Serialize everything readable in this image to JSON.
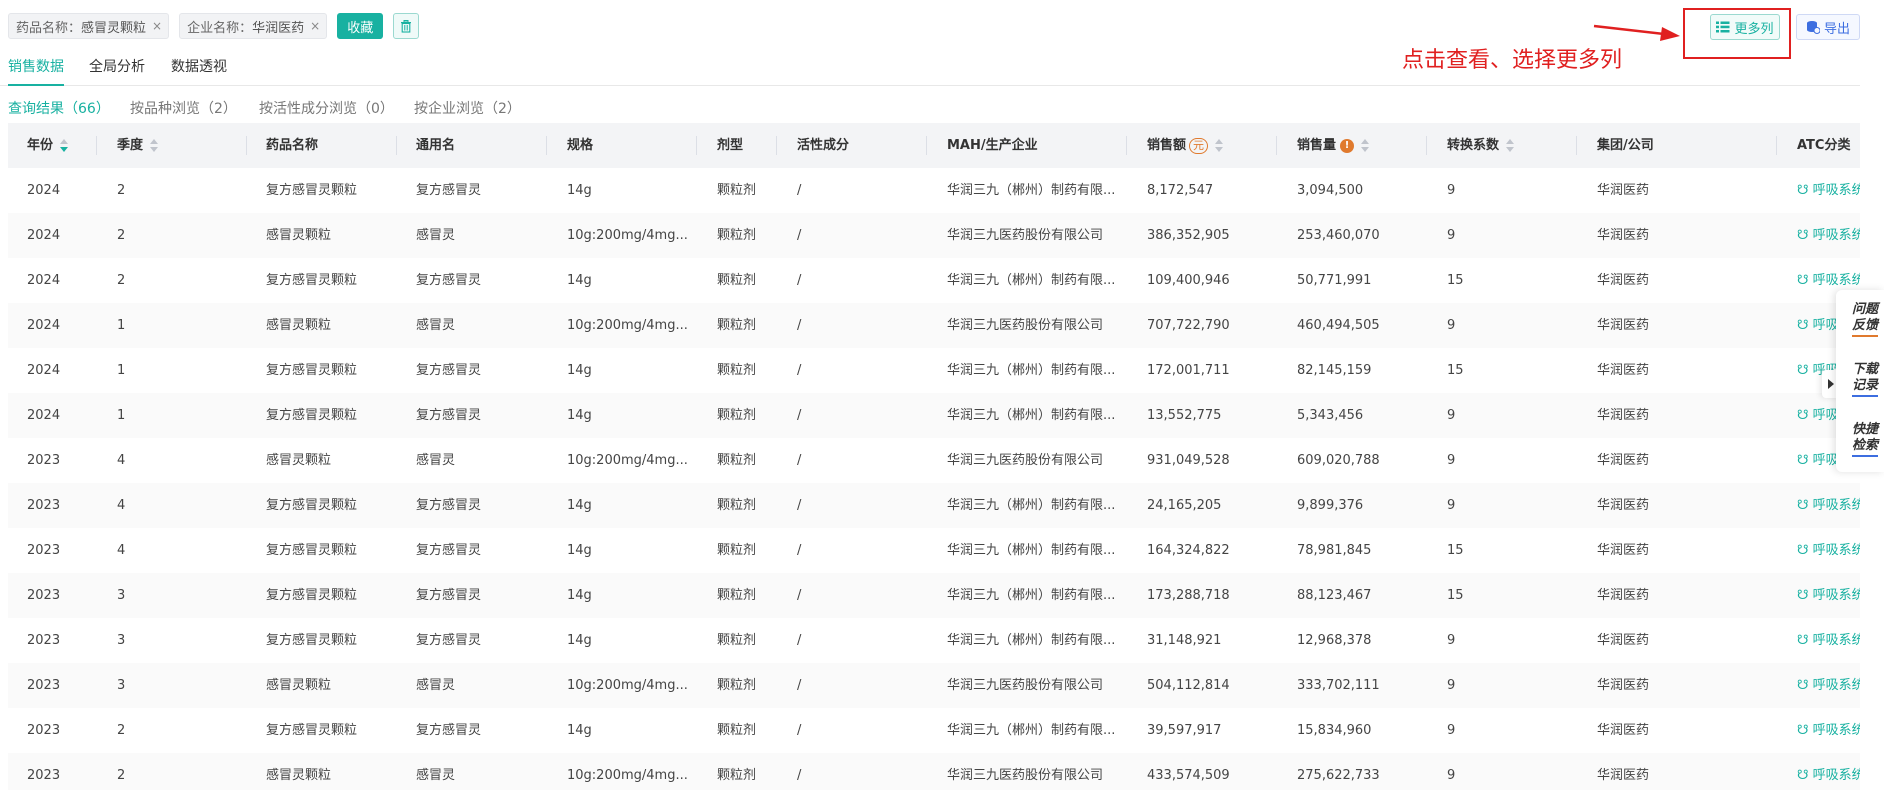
{
  "filters": {
    "tags": [
      {
        "label": "药品名称：",
        "value": "感冒灵颗粒",
        "close": "×"
      },
      {
        "label": "企业名称：",
        "value": "华润医药",
        "close": "×"
      }
    ],
    "favorite_label": "收藏"
  },
  "toolbar": {
    "more_columns_label": "更多列",
    "export_label": "导出"
  },
  "annotation": {
    "text": "点击查看、选择更多列",
    "color": "#e02020"
  },
  "main_tabs": [
    {
      "label": "销售数据",
      "active": true
    },
    {
      "label": "全局分析",
      "active": false
    },
    {
      "label": "数据透视",
      "active": false
    }
  ],
  "sub_tabs": [
    {
      "label": "查询结果（66）",
      "active": true
    },
    {
      "label": "按品种浏览（2）",
      "active": false
    },
    {
      "label": "按活性成分浏览（0）",
      "active": false
    },
    {
      "label": "按企业浏览（2）",
      "active": false
    }
  ],
  "table": {
    "columns": [
      {
        "key": "year",
        "label": "年份"
      },
      {
        "key": "quarter",
        "label": "季度"
      },
      {
        "key": "drug",
        "label": "药品名称"
      },
      {
        "key": "generic",
        "label": "通用名"
      },
      {
        "key": "spec",
        "label": "规格"
      },
      {
        "key": "form",
        "label": "剂型"
      },
      {
        "key": "active",
        "label": "活性成分"
      },
      {
        "key": "mah",
        "label": "MAH/生产企业"
      },
      {
        "key": "sales",
        "label": "销售额",
        "unit": "元"
      },
      {
        "key": "volume",
        "label": "销售量",
        "info": "!"
      },
      {
        "key": "factor",
        "label": "转换系数"
      },
      {
        "key": "group",
        "label": "集团/公司"
      },
      {
        "key": "atc",
        "label": "ATC分类"
      }
    ],
    "rows": [
      [
        "2024",
        "2",
        "复方感冒灵颗粒",
        "复方感冒灵",
        "14g",
        "颗粒剂",
        "/",
        "华润三九（郴州）制药有限...",
        "8,172,547",
        "3,094,500",
        "9",
        "华润医药",
        "☋ 呼吸系统"
      ],
      [
        "2024",
        "2",
        "感冒灵颗粒",
        "感冒灵",
        "10g:200mg/4mg...",
        "颗粒剂",
        "/",
        "华润三九医药股份有限公司",
        "386,352,905",
        "253,460,070",
        "9",
        "华润医药",
        "☋ 呼吸系统"
      ],
      [
        "2024",
        "2",
        "复方感冒灵颗粒",
        "复方感冒灵",
        "14g",
        "颗粒剂",
        "/",
        "华润三九（郴州）制药有限...",
        "109,400,946",
        "50,771,991",
        "15",
        "华润医药",
        "☋ 呼吸系统"
      ],
      [
        "2024",
        "1",
        "感冒灵颗粒",
        "感冒灵",
        "10g:200mg/4mg...",
        "颗粒剂",
        "/",
        "华润三九医药股份有限公司",
        "707,722,790",
        "460,494,505",
        "9",
        "华润医药",
        "☋ 呼吸系统"
      ],
      [
        "2024",
        "1",
        "复方感冒灵颗粒",
        "复方感冒灵",
        "14g",
        "颗粒剂",
        "/",
        "华润三九（郴州）制药有限...",
        "172,001,711",
        "82,145,159",
        "15",
        "华润医药",
        "☋ 呼吸系统"
      ],
      [
        "2024",
        "1",
        "复方感冒灵颗粒",
        "复方感冒灵",
        "14g",
        "颗粒剂",
        "/",
        "华润三九（郴州）制药有限...",
        "13,552,775",
        "5,343,456",
        "9",
        "华润医药",
        "☋ 呼吸系统"
      ],
      [
        "2023",
        "4",
        "感冒灵颗粒",
        "感冒灵",
        "10g:200mg/4mg...",
        "颗粒剂",
        "/",
        "华润三九医药股份有限公司",
        "931,049,528",
        "609,020,788",
        "9",
        "华润医药",
        "☋ 呼吸系统"
      ],
      [
        "2023",
        "4",
        "复方感冒灵颗粒",
        "复方感冒灵",
        "14g",
        "颗粒剂",
        "/",
        "华润三九（郴州）制药有限...",
        "24,165,205",
        "9,899,376",
        "9",
        "华润医药",
        "☋ 呼吸系统"
      ],
      [
        "2023",
        "4",
        "复方感冒灵颗粒",
        "复方感冒灵",
        "14g",
        "颗粒剂",
        "/",
        "华润三九（郴州）制药有限...",
        "164,324,822",
        "78,981,845",
        "15",
        "华润医药",
        "☋ 呼吸系统"
      ],
      [
        "2023",
        "3",
        "复方感冒灵颗粒",
        "复方感冒灵",
        "14g",
        "颗粒剂",
        "/",
        "华润三九（郴州）制药有限...",
        "173,288,718",
        "88,123,467",
        "15",
        "华润医药",
        "☋ 呼吸系统"
      ],
      [
        "2023",
        "3",
        "复方感冒灵颗粒",
        "复方感冒灵",
        "14g",
        "颗粒剂",
        "/",
        "华润三九（郴州）制药有限...",
        "31,148,921",
        "12,968,378",
        "9",
        "华润医药",
        "☋ 呼吸系统"
      ],
      [
        "2023",
        "3",
        "感冒灵颗粒",
        "感冒灵",
        "10g:200mg/4mg...",
        "颗粒剂",
        "/",
        "华润三九医药股份有限公司",
        "504,112,814",
        "333,702,111",
        "9",
        "华润医药",
        "☋ 呼吸系统"
      ],
      [
        "2023",
        "2",
        "复方感冒灵颗粒",
        "复方感冒灵",
        "14g",
        "颗粒剂",
        "/",
        "华润三九（郴州）制药有限...",
        "39,597,917",
        "15,834,960",
        "9",
        "华润医药",
        "☋ 呼吸系统"
      ],
      [
        "2023",
        "2",
        "感冒灵颗粒",
        "感冒灵",
        "10g:200mg/4mg...",
        "颗粒剂",
        "/",
        "华润三九医药股份有限公司",
        "433,574,509",
        "275,622,733",
        "9",
        "华润医药",
        "☋ 呼吸系统"
      ]
    ]
  },
  "side_panel": {
    "items": [
      {
        "label": "问题反馈",
        "accent": "#e07a2e"
      },
      {
        "label": "下载记录",
        "accent": "#3d6ee0"
      },
      {
        "label": "快捷检索",
        "accent": "#3d6ee0"
      }
    ]
  },
  "colors": {
    "primary": "#18b1a1",
    "export_blue": "#3d6ee0",
    "warning_orange": "#e07a2e"
  }
}
